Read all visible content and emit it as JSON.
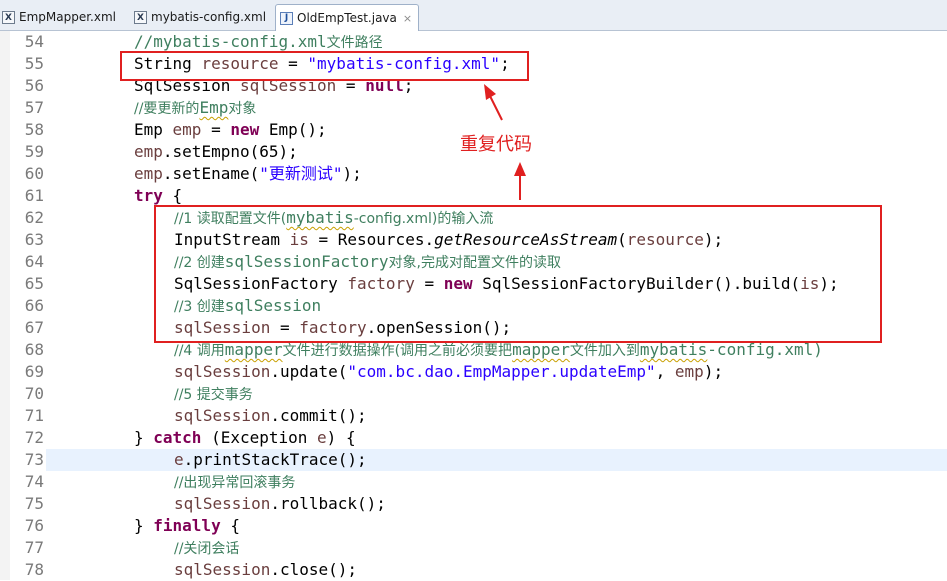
{
  "tabs": [
    {
      "label": "EmpMapper.xml",
      "icon": "xml-file-icon"
    },
    {
      "label": "mybatis-config.xml",
      "icon": "xml-file-icon"
    },
    {
      "label": "OldEmpTest.java",
      "icon": "java-file-icon",
      "active": true,
      "close": "×"
    }
  ],
  "lines": {
    "l54": {
      "num": "54",
      "c1": "//mybatis-config.xml",
      "c2": "文件路径"
    },
    "l55": {
      "num": "55",
      "t1": "String ",
      "t2": "resource",
      "t3": " = ",
      "t4": "\"mybatis-config.xml\"",
      "t5": ";"
    },
    "l56": {
      "num": "56",
      "t1": "SqlSession ",
      "t2": "sqlSession",
      "t3": " = ",
      "t4": "null",
      "t5": ";"
    },
    "l57": {
      "num": "57",
      "c1": "//要更新的",
      "c2": "Emp",
      "c3": "对象"
    },
    "l58": {
      "num": "58",
      "t1": "Emp ",
      "t2": "emp",
      "t3": " = ",
      "t4": "new",
      "t5": " Emp();"
    },
    "l59": {
      "num": "59",
      "t1": "emp",
      "t2": ".setEmpno(65);"
    },
    "l60": {
      "num": "60",
      "t1": "emp",
      "t2": ".setEname(",
      "t3": "\"更新测试\"",
      "t4": ");"
    },
    "l61": {
      "num": "61",
      "t1": "try",
      "t2": " {"
    },
    "l62": {
      "num": "62",
      "c1": "//1 读取配置文件(",
      "c2": "mybatis",
      "c3": "-config.xml)的输入流"
    },
    "l63": {
      "num": "63",
      "t1": "InputStream ",
      "t2": "is",
      "t3": " = Resources.",
      "t4": "getResourceAsStream",
      "t5": "(",
      "t6": "resource",
      "t7": ");"
    },
    "l64": {
      "num": "64",
      "c1": "//2 创建",
      "c2": "sqlSessionFactory",
      "c3": "对象,完成对配置文件的读取"
    },
    "l65": {
      "num": "65",
      "t1": "SqlSessionFactory ",
      "t2": "factory",
      "t3": " = ",
      "t4": "new",
      "t5": " SqlSessionFactoryBuilder().build(",
      "t6": "is",
      "t7": ");"
    },
    "l66": {
      "num": "66",
      "c1": "//3 创建",
      "c2": "sqlSession"
    },
    "l67": {
      "num": "67",
      "t1": "sqlSession",
      "t2": " = ",
      "t3": "factory",
      "t4": ".openSession();"
    },
    "l68": {
      "num": "68",
      "c1": "//4 调用",
      "c2": "mapper",
      "c3": "文件进行数据操作(调用之前必须要把",
      "c4": "mapper",
      "c5": "文件加入到",
      "c6": "mybatis",
      "c7": "-config.xml)"
    },
    "l69": {
      "num": "69",
      "t1": "sqlSession",
      "t2": ".update(",
      "t3": "\"com.bc.dao.EmpMapper.updateEmp\"",
      "t4": ", ",
      "t5": "emp",
      "t6": ");"
    },
    "l70": {
      "num": "70",
      "c1": "//5 提交事务"
    },
    "l71": {
      "num": "71",
      "t1": "sqlSession",
      "t2": ".commit();"
    },
    "l72": {
      "num": "72",
      "t1": "} ",
      "t2": "catch",
      "t3": " (Exception ",
      "t4": "e",
      "t5": ") {"
    },
    "l73": {
      "num": "73",
      "t1": "e",
      "t2": ".printStackTrace();"
    },
    "l74": {
      "num": "74",
      "c1": "//出现异常回滚事务"
    },
    "l75": {
      "num": "75",
      "t1": "sqlSession",
      "t2": ".rollback();"
    },
    "l76": {
      "num": "76",
      "t1": "} ",
      "t2": "finally",
      "t3": " {"
    },
    "l77": {
      "num": "77",
      "c1": "//关闭会话"
    },
    "l78": {
      "num": "78",
      "t1": "sqlSession",
      "t2": ".close();"
    }
  },
  "annotation": {
    "label": "重复代码",
    "color": "#e02020"
  },
  "colors": {
    "keyword": "#7f0055",
    "comment": "#3f7f5f",
    "string": "#2a00ff",
    "field": "#0000c0",
    "highlight_line": "#e8f2fe"
  }
}
